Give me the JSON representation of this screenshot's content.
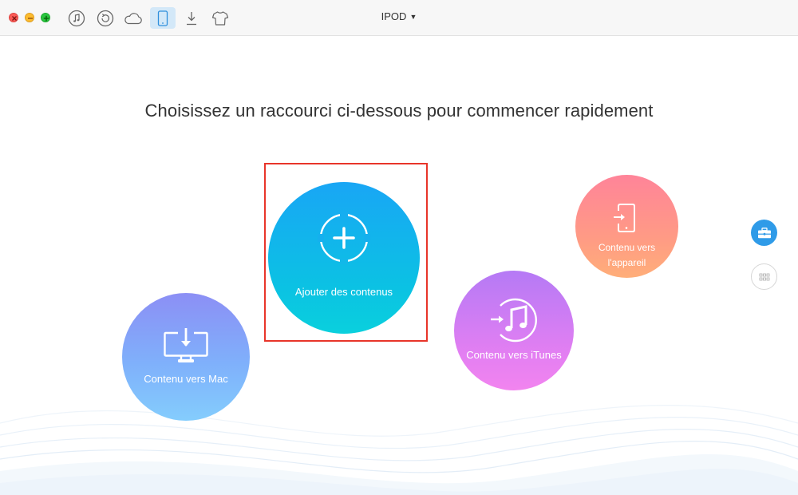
{
  "window": {
    "device_name": "IPOD",
    "heading": "Choisissez un raccourci ci-dessous pour commencer rapidement"
  },
  "toolbar": {
    "items": [
      {
        "name": "music-manager",
        "icon": "music-note-icon",
        "active": false
      },
      {
        "name": "backup-restore",
        "icon": "restore-icon",
        "active": false
      },
      {
        "name": "cloud",
        "icon": "cloud-icon",
        "active": false
      },
      {
        "name": "device-manager",
        "icon": "iphone-icon",
        "active": true
      },
      {
        "name": "downloader",
        "icon": "download-icon",
        "active": false
      },
      {
        "name": "skin",
        "icon": "tshirt-icon",
        "active": false
      }
    ]
  },
  "shortcuts": {
    "add": {
      "label": "Ajouter des contenus",
      "icon": "add-circle-icon",
      "color": "#19a6f5"
    },
    "to_mac": {
      "label": "Contenu vers Mac",
      "icon": "monitor-download-icon",
      "color": "#8c8ff5"
    },
    "to_itunes": {
      "label": "Contenu vers iTunes",
      "icon": "itunes-transfer-icon",
      "color": "#d07cf3"
    },
    "to_device": {
      "label_line1": "Contenu vers",
      "label_line2": "l'appareil",
      "icon": "phone-import-icon",
      "color": "#ff8c8f"
    }
  },
  "side": {
    "toolbox_icon": "toolbox-icon",
    "grid_icon": "grid-icon"
  },
  "colors": {
    "highlight": "#e8352a",
    "accent": "#2f9be8"
  }
}
